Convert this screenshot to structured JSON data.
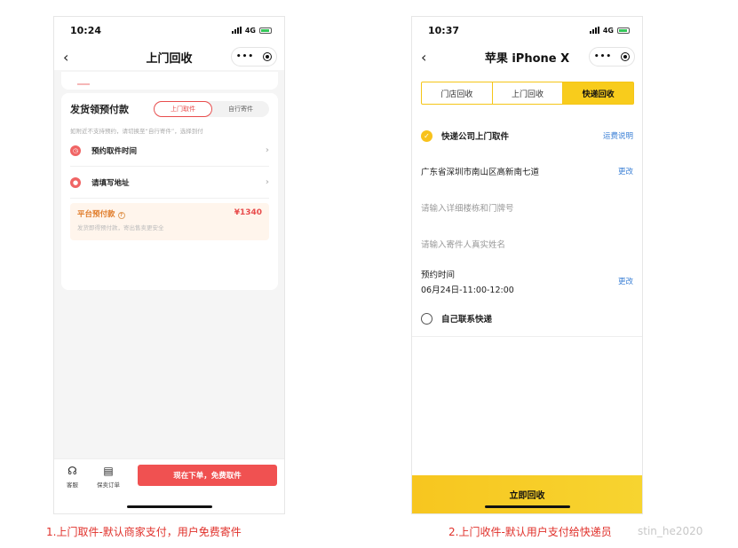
{
  "left": {
    "status_time": "10:24",
    "network": "4G",
    "nav_title": "上门回收",
    "section_title": "发货领预付款",
    "seg_options": [
      "上门取件",
      "自行寄件"
    ],
    "hint": "如附近不支持预约，请切换至“自行寄件”，选择到付",
    "rows": [
      "预约取件时间",
      "请填写地址"
    ],
    "advance_title": "平台预付款",
    "advance_amount": "¥1340",
    "advance_sub": "发货即得预付款，寄出售卖更安全",
    "bottom_service": "客服",
    "bottom_orders": "保卖订单",
    "cta": "现在下单，免费取件",
    "caption": "1.上门取件-默认商家支付，用户免费寄件"
  },
  "right": {
    "status_time": "10:37",
    "network": "4G",
    "nav_title": "苹果 iPhone X",
    "tabs": [
      "门店回收",
      "上门回收",
      "快递回收"
    ],
    "courier_label": "快递公司上门取件",
    "fee_link": "运费说明",
    "address": "广东省深圳市南山区高新南七道",
    "change": "更改",
    "detail_placeholder": "请输入详细楼栋和门牌号",
    "name_placeholder": "请输入寄件人真实姓名",
    "time_label": "预约时间",
    "time_value": "06月24日-11:00-12:00",
    "self_contact": "自己联系快递",
    "cta": "立即回收",
    "caption": "2.上门收件-默认用户支付给快递员",
    "watermark": "stin_he2020"
  },
  "colors": {
    "red": "#f05151",
    "yellow": "#f8cc1c",
    "link": "#3a7fd5"
  }
}
